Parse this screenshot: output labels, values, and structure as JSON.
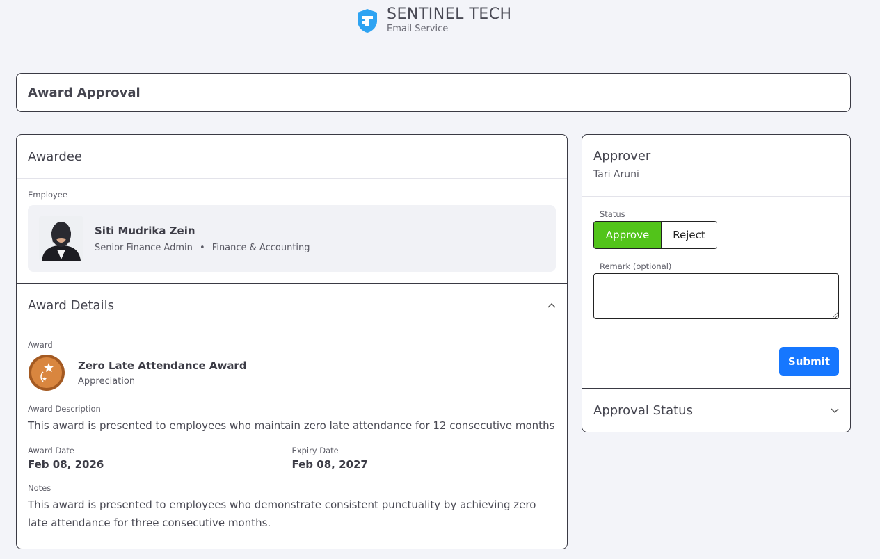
{
  "brand": {
    "name": "SENTINEL TECH",
    "subtitle": "Email Service",
    "color": "#2ea3f2",
    "icon": "shield-icon"
  },
  "page": {
    "title": "Award Approval"
  },
  "awardee": {
    "section_title": "Awardee",
    "employee_label": "Employee",
    "name": "Siti Mudrika Zein",
    "position": "Senior Finance Admin",
    "separator": "•",
    "department": "Finance & Accounting"
  },
  "award_details": {
    "section_title": "Award Details",
    "collapse_icon": "chevron-up-icon",
    "award_label": "Award",
    "award_name": "Zero Late Attendance Award",
    "award_type": "Appreciation",
    "medal_icon": "medal-icon",
    "description_label": "Award Description",
    "description": "This award is presented to employees who maintain zero late attendance for 12 consecutive months",
    "award_date_label": "Award Date",
    "award_date": "Feb 08, 2026",
    "expiry_date_label": "Expiry Date",
    "expiry_date": "Feb 08, 2027",
    "notes_label": "Notes",
    "notes": "This award is presented to employees who demonstrate consistent punctuality by achieving zero late attendance for three consecutive months."
  },
  "approver": {
    "section_title": "Approver",
    "name": "Tari Aruni",
    "status_label": "Status",
    "approve_label": "Approve",
    "reject_label": "Reject",
    "selected_status": "Approve",
    "remark_label": "Remark (optional)",
    "remark_value": "",
    "submit_label": "Submit",
    "approve_color": "#52c41a",
    "submit_color": "#1677ff"
  },
  "approval_status": {
    "section_title": "Approval Status",
    "expand_icon": "chevron-down-icon"
  }
}
